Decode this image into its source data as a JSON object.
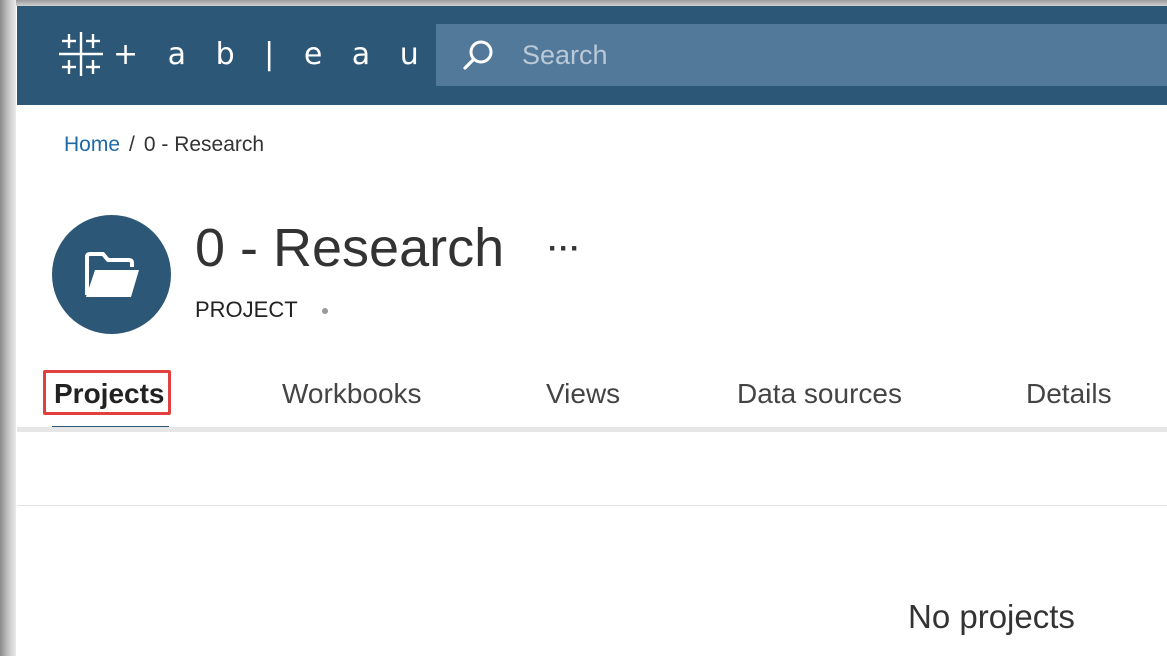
{
  "header": {
    "logo_text": "+ a b | e a u",
    "search": {
      "placeholder": "Search",
      "icon": "search-icon"
    },
    "background_color": "#2d5777",
    "search_background_color": "#52799a"
  },
  "breadcrumb": {
    "home_label": "Home",
    "separator": "/",
    "current": "0 - Research"
  },
  "project": {
    "title": "0 - Research",
    "more_label": "···",
    "type_label": "PROJECT",
    "icon": "folder-icon"
  },
  "tabs": [
    {
      "label": "Projects",
      "active": true
    },
    {
      "label": "Workbooks",
      "active": false
    },
    {
      "label": "Views",
      "active": false
    },
    {
      "label": "Data sources",
      "active": false
    },
    {
      "label": "Details",
      "active": false
    }
  ],
  "highlight_color": "#e0413f",
  "content": {
    "empty_message": "No projects"
  }
}
